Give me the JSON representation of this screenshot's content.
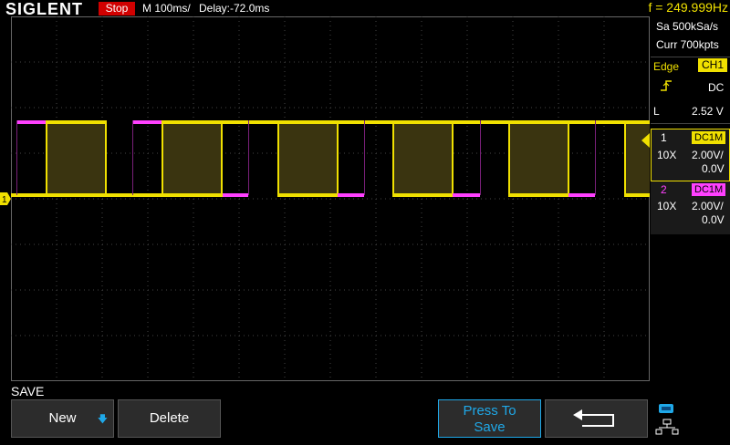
{
  "header": {
    "brand": "SIGLENT",
    "run_state": "Stop",
    "timebase": "M 100ms/",
    "delay": "Delay:-72.0ms",
    "frequency": "f = 249.999Hz"
  },
  "acquisition": {
    "sample_rate": "Sa 500kSa/s",
    "memory_depth": "Curr 700kpts"
  },
  "trigger": {
    "type": "Edge",
    "source": "CH1",
    "coupling": "DC",
    "level_label": "L",
    "level_value": "2.52 V"
  },
  "channels": [
    {
      "num": "1",
      "coupling_tag": "DC1M",
      "probe": "10X",
      "scale": "2.00V/",
      "offset": "0.0V",
      "color": "#f0e000",
      "marker": "1"
    },
    {
      "num": "2",
      "coupling_tag": "DC1M",
      "probe": "10X",
      "scale": "2.00V/",
      "offset": "0.0V",
      "color": "#ff40ff"
    }
  ],
  "menu": {
    "title": "SAVE",
    "new_label": "New",
    "delete_label": "Delete",
    "press_to_save_line1": "Press To",
    "press_to_save_line2": "Save"
  },
  "icons": {
    "back": "return-arrow-icon",
    "network": "network-icon",
    "slope": "rising-edge-icon"
  }
}
